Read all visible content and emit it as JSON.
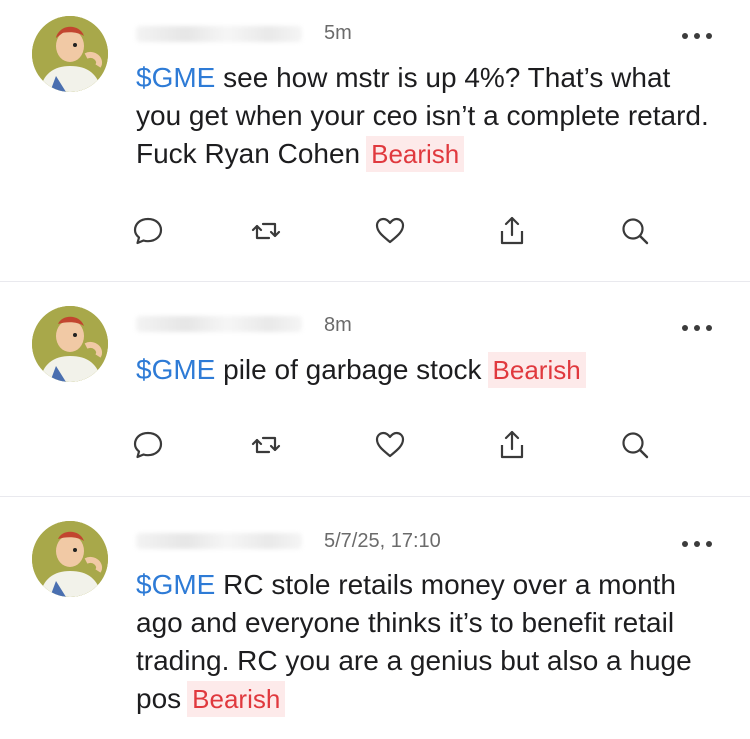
{
  "posts": [
    {
      "time": "5m",
      "cashtag": "$GME",
      "text": " see how mstr is up 4%? That’s what you get when your ceo isn’t a complete retard. Fuck Ryan Cohen",
      "sentiment": "Bearish"
    },
    {
      "time": "8m",
      "cashtag": "$GME",
      "text": " pile of garbage stock",
      "sentiment": "Bearish"
    },
    {
      "time": "5/7/25, 17:10",
      "cashtag": "$GME",
      "text": " RC stole retails money over a month ago and everyone thinks it’s to benefit retail trading. RC you are a genius but also a huge pos",
      "sentiment": "Bearish"
    }
  ],
  "colors": {
    "cashtag": "#2e7bd6",
    "bearish_text": "#e0393e",
    "bearish_bg": "#fdeaea"
  },
  "icons": [
    "comment-icon",
    "repost-icon",
    "like-icon",
    "share-icon",
    "search-icon"
  ]
}
